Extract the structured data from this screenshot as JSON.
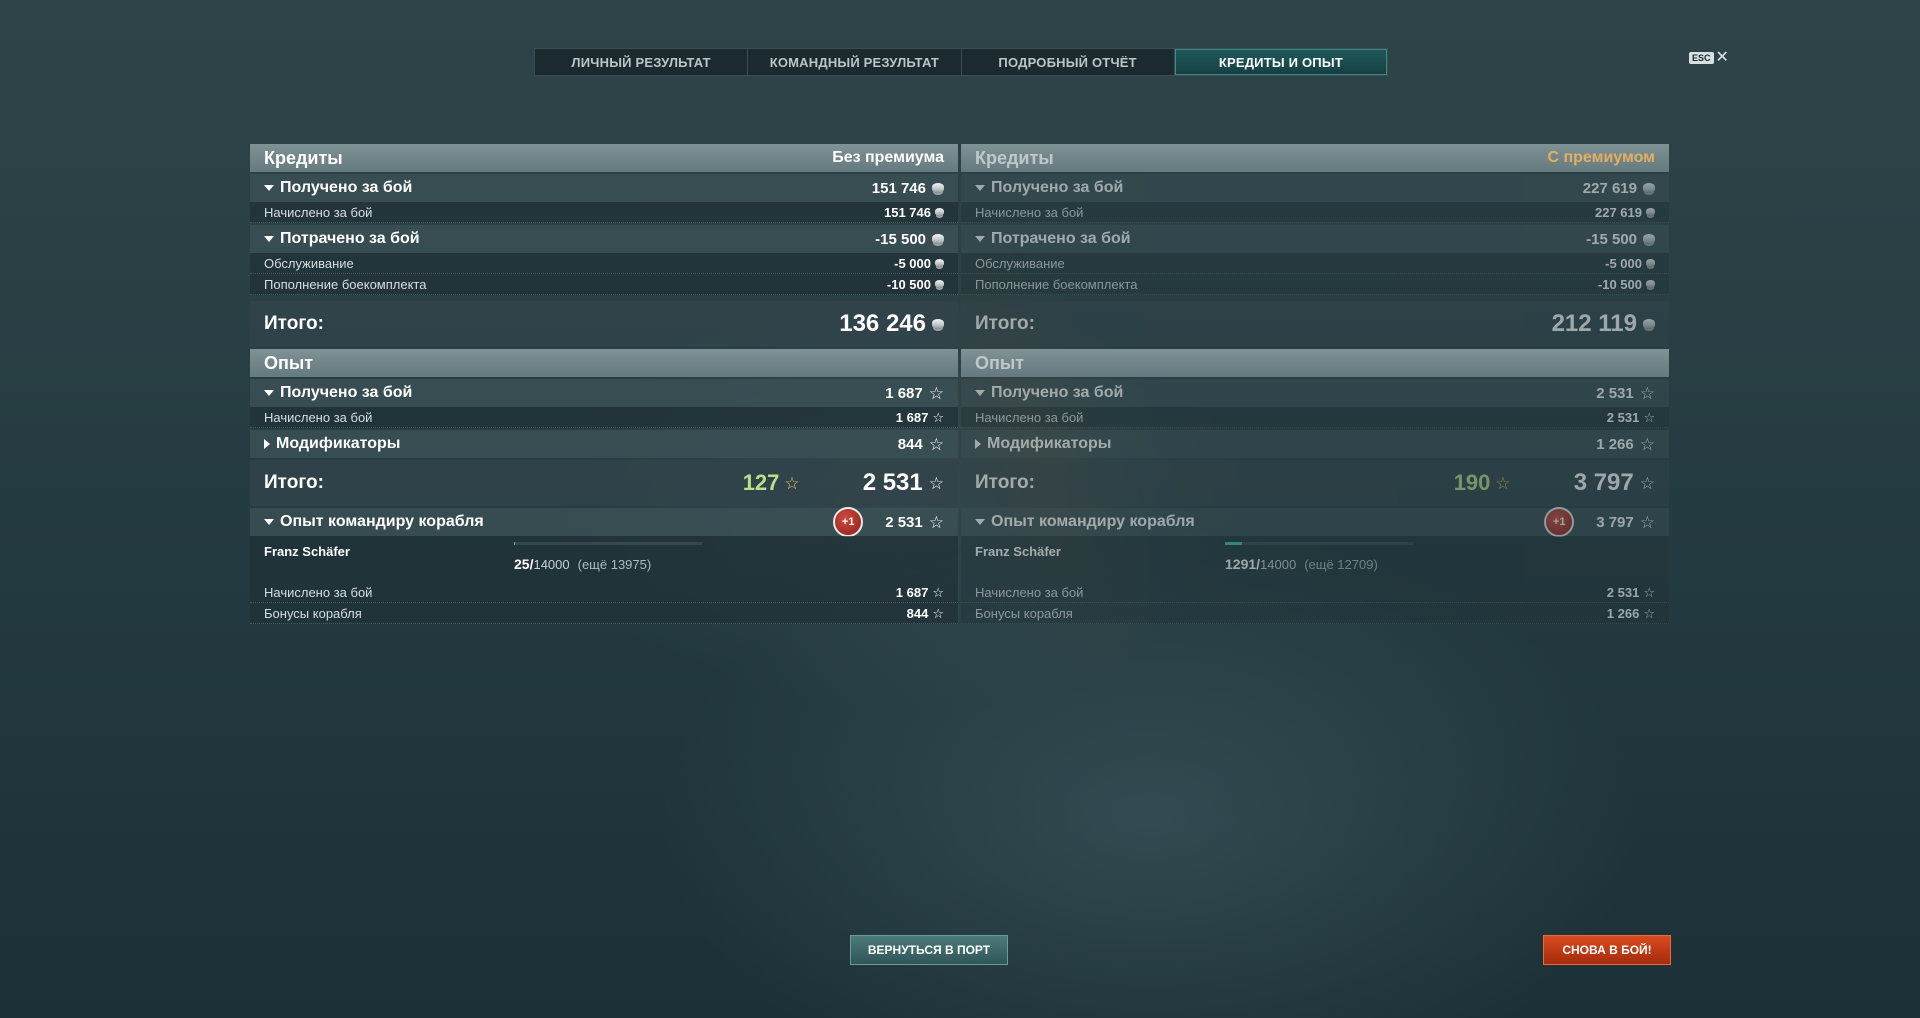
{
  "tabs": [
    "ЛИЧНЫЙ РЕЗУЛЬТАТ",
    "КОМАНДНЫЙ РЕЗУЛЬТАТ",
    "ПОДРОБНЫЙ ОТЧЁТ",
    "КРЕДИТЫ И ОПЫТ"
  ],
  "active_tab": "КРЕДИТЫ И ОПЫТ",
  "esc_label": "ESC",
  "close_glyph": "✕",
  "labels": {
    "credits": "Кредиты",
    "earned": "Получено за бой",
    "accrued": "Начислено за бой",
    "spent": "Потрачено за бой",
    "service": "Обслуживание",
    "ammo": "Пополнение боекомплекта",
    "total": "Итого:",
    "exp": "Опыт",
    "modifiers": "Модификаторы",
    "commander_exp": "Опыт командиру корабля",
    "ship_bonus": "Бонусы корабля",
    "badge": "+1"
  },
  "left": {
    "mode": "Без премиума",
    "credits_earned": "151 746",
    "credits_accrued": "151 746",
    "credits_spent": "-15 500",
    "service": "-5 000",
    "ammo": "-10 500",
    "credits_total": "136 246",
    "exp_earned": "1 687",
    "exp_accrued": "1 687",
    "modifiers": "844",
    "bonus_exp": "127",
    "exp_total": "2 531",
    "commander_exp": "2 531",
    "commander_name": "Franz Schäfer",
    "progress_current": "25/",
    "progress_max": "14000",
    "progress_remaining": "(ещё 13975)",
    "progress_fraction": 0.0018,
    "cmd_accrued": "1 687",
    "cmd_ship_bonus": "844"
  },
  "right": {
    "mode": "С премиумом",
    "credits_earned": "227 619",
    "credits_accrued": "227 619",
    "credits_spent": "-15 500",
    "service": "-5 000",
    "ammo": "-10 500",
    "credits_total": "212 119",
    "exp_earned": "2 531",
    "exp_accrued": "2 531",
    "modifiers": "1 266",
    "bonus_exp": "190",
    "exp_total": "3 797",
    "commander_exp": "3 797",
    "commander_name": "Franz Schäfer",
    "progress_current": "1291/",
    "progress_max": "14000",
    "progress_remaining": "(ещё 12709)",
    "progress_fraction": 0.092,
    "cmd_accrued": "2 531",
    "cmd_ship_bonus": "1 266"
  },
  "buttons": {
    "port": "ВЕРНУТЬСЯ В ПОРТ",
    "battle": "СНОВА В БОЙ!"
  },
  "colors": {
    "accent": "#3ec7a5",
    "premium": "#e0b060",
    "bonus_exp": "#b8e089",
    "battle_button": "#d94a1f"
  }
}
